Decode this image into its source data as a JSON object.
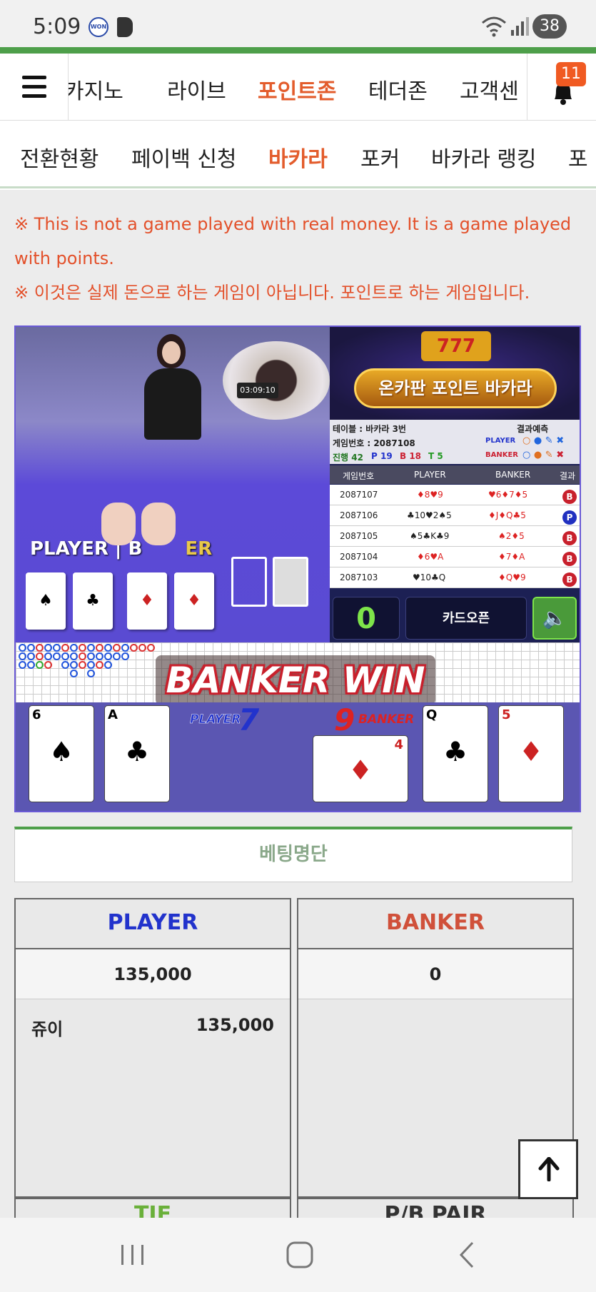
{
  "status_bar": {
    "time": "5:09",
    "battery": "38",
    "won_badge": "WON"
  },
  "nav_top": {
    "tabs": [
      "카지노",
      "라이브",
      "포인트존",
      "테더존",
      "고객센"
    ],
    "active": "포인트존",
    "notification_count": "11"
  },
  "nav_sub": {
    "tabs": [
      "전환현황",
      "페이백 신청",
      "바카라",
      "포커",
      "바카라 랭킹",
      "포"
    ],
    "active": "바카라"
  },
  "notice": {
    "line1": "※ This is not a game played with real money. It is a game played",
    "line2": "with points.",
    "line3": "※ 이것은 실제 돈으로 하는 게임이 아닙니다. 포인트로 하는 게임입니다."
  },
  "game": {
    "felt_player": "PLAYER",
    "felt_banker": "BANKER",
    "felt_banker_visible": "B",
    "felt_banker_tail": "ER",
    "roulette_timer": "03:09:10",
    "logo_slot": "777",
    "logo_title": "온카판 포인트 바카라",
    "table_label": "테이블 : 바카라 3번",
    "prediction_label": "결과예측",
    "game_no_label": "게임번호 : 2087108",
    "progress": "진행 42",
    "p_count": "P 19",
    "b_count": "B 18",
    "t_count": "T 5",
    "pred_player": "PLAYER",
    "pred_banker": "BANKER",
    "history_headers": [
      "게임번호",
      "PLAYER",
      "BANKER",
      "결과"
    ],
    "history": [
      {
        "no": "2087107",
        "player": "♦8♥9",
        "banker": "♥6♦7♦5",
        "result": "B"
      },
      {
        "no": "2087106",
        "player": "♣10♥2♠5",
        "banker": "♦J♦Q♣5",
        "result": "P"
      },
      {
        "no": "2087105",
        "player": "♠5♣K♣9",
        "banker": "♠2♦5",
        "result": "B"
      },
      {
        "no": "2087104",
        "player": "♦6♥A",
        "banker": "♦7♦A",
        "result": "B"
      },
      {
        "no": "2087103",
        "player": "♥10♣Q",
        "banker": "♦Q♥9",
        "result": "B"
      }
    ],
    "counter": "0",
    "card_open_button": "카드오픈",
    "sound_icon": "speaker-icon",
    "win_text": "BANKER WIN",
    "player_label": "PLAYER",
    "player_score": "7",
    "banker_label": "BANKER",
    "banker_score": "9",
    "player_cards": [
      {
        "rank": "6",
        "suit": "♠"
      },
      {
        "rank": "A",
        "suit": "♣"
      }
    ],
    "banker_cards": [
      {
        "rank": "4",
        "suit": "♦"
      },
      {
        "rank": "Q",
        "suit": "♣"
      },
      {
        "rank": "5",
        "suit": "♦"
      }
    ]
  },
  "bet_list": {
    "title": "베팅명단",
    "player": {
      "label": "PLAYER",
      "total": "135,000",
      "rows": [
        {
          "name": "쥬이",
          "amount": "135,000"
        }
      ]
    },
    "banker": {
      "label": "BANKER",
      "total": "0"
    },
    "tie_label": "TIE",
    "pair_label": "P/B PAIR"
  },
  "colors": {
    "accent": "#e35c2c",
    "green": "#4e9f4a",
    "player_blue": "#2233cc",
    "banker_red": "#d0503a"
  }
}
